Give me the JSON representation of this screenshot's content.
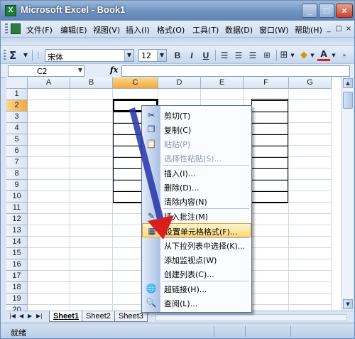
{
  "window": {
    "title": "Microsoft Excel - Book1"
  },
  "menubar": {
    "items": [
      "文件(F)",
      "编辑(E)",
      "视图(V)",
      "插入(I)",
      "格式(O)",
      "工具(T)",
      "数据(D)",
      "窗口(W)",
      "帮助(H)"
    ],
    "mdi_buttons": [
      "_",
      "□",
      "×"
    ]
  },
  "toolbar": {
    "sigma": "Σ",
    "font_name": "宋体",
    "font_size": "12",
    "bold": "B",
    "italic": "I",
    "underline": "U",
    "font_color_label": "A"
  },
  "formula_bar": {
    "name_box": "C2",
    "fx": "fx",
    "content": ""
  },
  "grid": {
    "columns": [
      "A",
      "B",
      "C",
      "D",
      "E",
      "F",
      "G"
    ],
    "rows": [
      "1",
      "2",
      "3",
      "4",
      "5",
      "6",
      "7",
      "8",
      "9",
      "10",
      "11",
      "12",
      "13",
      "14",
      "15",
      "16",
      "17",
      "18",
      "19",
      "20"
    ],
    "selected_column": "C",
    "selected_row": "2"
  },
  "sheets": {
    "tabs": [
      "Sheet1",
      "Sheet2",
      "Sheet3"
    ],
    "active": "Sheet1"
  },
  "statusbar": {
    "text": "就绪"
  },
  "context_menu": {
    "items": [
      {
        "label": "剪切(T)",
        "icon": "scissors-icon",
        "disabled": false
      },
      {
        "label": "复制(C)",
        "icon": "copy-icon",
        "disabled": false
      },
      {
        "label": "粘贴(P)",
        "icon": "paste-icon",
        "disabled": true
      },
      {
        "label": "选择性粘贴(S)...",
        "icon": "",
        "disabled": true
      },
      {
        "label": "插入(I)...",
        "icon": "",
        "disabled": false
      },
      {
        "label": "删除(D)...",
        "icon": "",
        "disabled": false
      },
      {
        "label": "清除内容(N)",
        "icon": "",
        "disabled": false
      },
      {
        "label": "插入批注(M)",
        "icon": "comment-icon",
        "disabled": false
      },
      {
        "label": "设置单元格格式(F)...",
        "icon": "format-cells-icon",
        "disabled": false,
        "highlighted": true
      },
      {
        "label": "从下拉列表中选择(K)...",
        "icon": "",
        "disabled": false
      },
      {
        "label": "添加监视点(W)",
        "icon": "",
        "disabled": false
      },
      {
        "label": "创建列表(C)...",
        "icon": "",
        "disabled": false
      },
      {
        "label": "超链接(H)...",
        "icon": "hyperlink-icon",
        "disabled": false
      },
      {
        "label": "查阅(L)...",
        "icon": "research-icon",
        "disabled": false
      }
    ]
  },
  "colors": {
    "accent_arrow": "#2432a8",
    "pointer": "#d81f1f",
    "highlight": "#ffd97a"
  }
}
